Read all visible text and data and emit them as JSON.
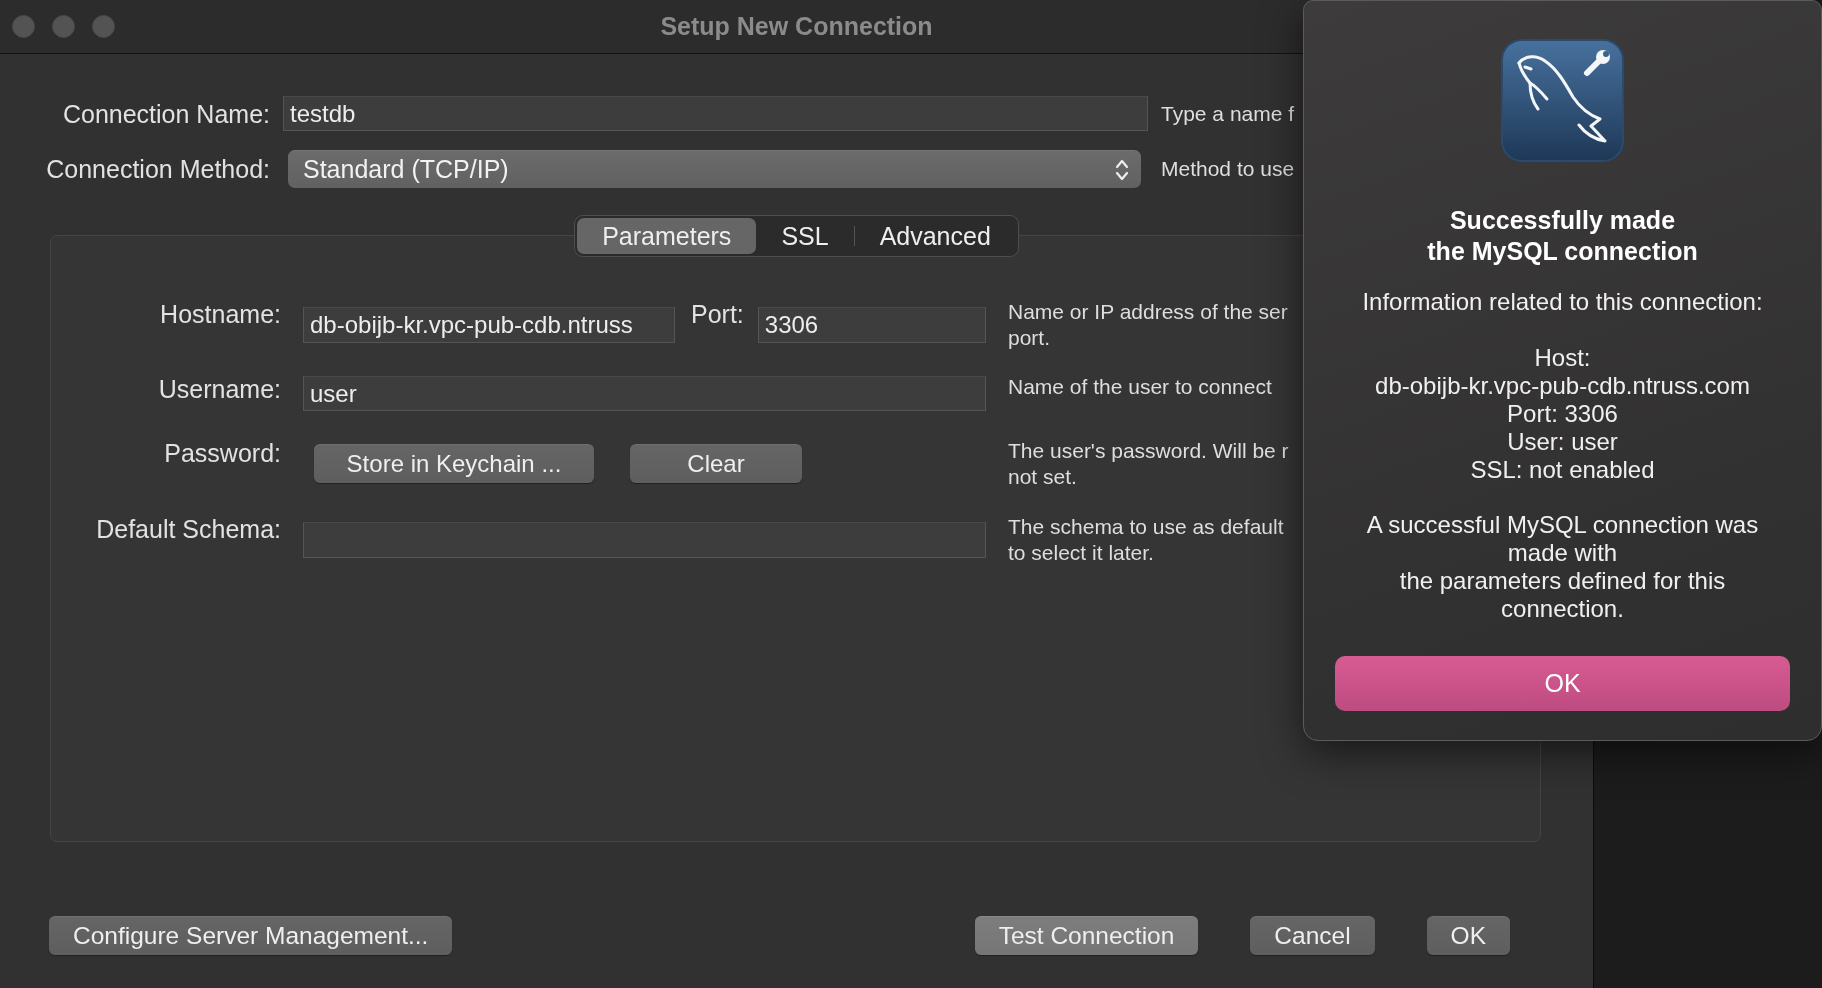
{
  "window": {
    "title": "Setup New Connection"
  },
  "connection": {
    "name": {
      "label": "Connection Name:",
      "value": "testdb",
      "help": "Type a name f"
    },
    "method": {
      "label": "Connection Method:",
      "value": "Standard (TCP/IP)",
      "help": "Method to use"
    }
  },
  "tabs": [
    {
      "label": "Parameters",
      "selected": true
    },
    {
      "label": "SSL",
      "selected": false
    },
    {
      "label": "Advanced",
      "selected": false
    }
  ],
  "parameters": {
    "hostname": {
      "label": "Hostname:",
      "value": "db-obijb-kr.vpc-pub-cdb.ntruss",
      "help": "Name or IP address of the ser\nport."
    },
    "port": {
      "label": "Port:",
      "value": "3306"
    },
    "username": {
      "label": "Username:",
      "value": "user",
      "help": "Name of the user to connect"
    },
    "password": {
      "label": "Password:",
      "buttons": [
        "Store in Keychain ...",
        "Clear"
      ],
      "help": "The user's password. Will be r\nnot set."
    },
    "default_schema": {
      "label": "Default Schema:",
      "help": "The schema to use as default\nto select it later."
    }
  },
  "footer": {
    "start_buttons": [
      {
        "label": "Configure Server Management...",
        "highlighted": false
      }
    ],
    "end_buttons": [
      {
        "label": "Test Connection",
        "highlighted": true
      },
      {
        "label": "Cancel",
        "highlighted": false
      },
      {
        "label": "OK",
        "highlighted": false
      }
    ]
  },
  "alert": {
    "title": "Successfully made\nthe MySQL connection",
    "intro": "Information related to this connection:",
    "details": "Host:\ndb-obijb-kr.vpc-pub-cdb.ntruss.com\nPort: 3306\nUser: user\nSSL: not enabled",
    "summary": "A successful MySQL connection was\nmade with\nthe parameters defined for this\nconnection.",
    "button": "OK"
  }
}
